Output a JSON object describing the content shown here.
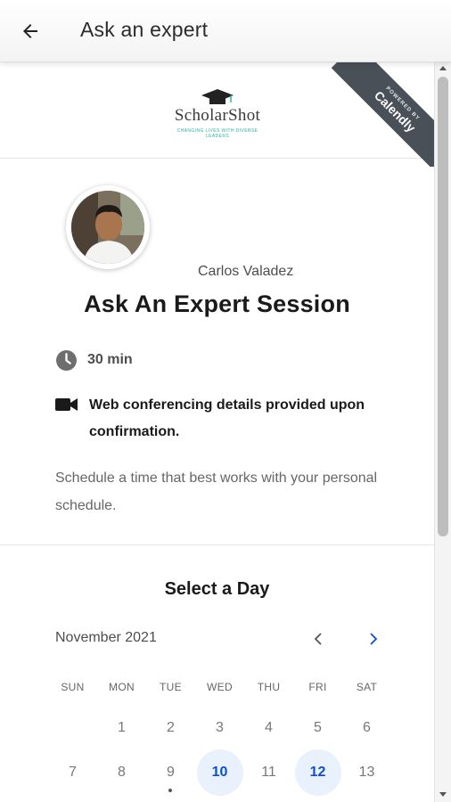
{
  "header": {
    "title": "Ask an expert"
  },
  "branding": {
    "logo_text": "ScholarShot",
    "logo_tagline": "CHANGING LIVES WITH DIVERSE LEADERS",
    "ribbon_small": "POWERED BY",
    "ribbon_brand": "Calendly",
    "ribbon_color": "#4a5058",
    "logo_accent": "#2bb3a8"
  },
  "event": {
    "host_name": "Carlos Valadez",
    "title": "Ask An Expert Session",
    "duration": "30 min",
    "conferencing": "Web conferencing details provided upon confirmation.",
    "description": "Schedule a time that best works with your personal schedule."
  },
  "calendar": {
    "heading": "Select a Day",
    "month": "November 2021",
    "weekdays": [
      "SUN",
      "MON",
      "TUE",
      "WED",
      "THU",
      "FRI",
      "SAT"
    ],
    "week1": [
      "",
      "1",
      "2",
      "3",
      "4",
      "5",
      "6"
    ],
    "week2": [
      "7",
      "8",
      "9",
      "10",
      "11",
      "12",
      "13"
    ],
    "available_days": [
      "10",
      "12"
    ],
    "today": "9",
    "available_color": "#0d4fd1",
    "available_bg": "#e8f1fc"
  },
  "icons": {
    "back": "arrow-left-icon",
    "clock": "clock-icon",
    "video": "video-camera-icon",
    "prev": "chevron-left-icon",
    "next": "chevron-right-icon"
  }
}
